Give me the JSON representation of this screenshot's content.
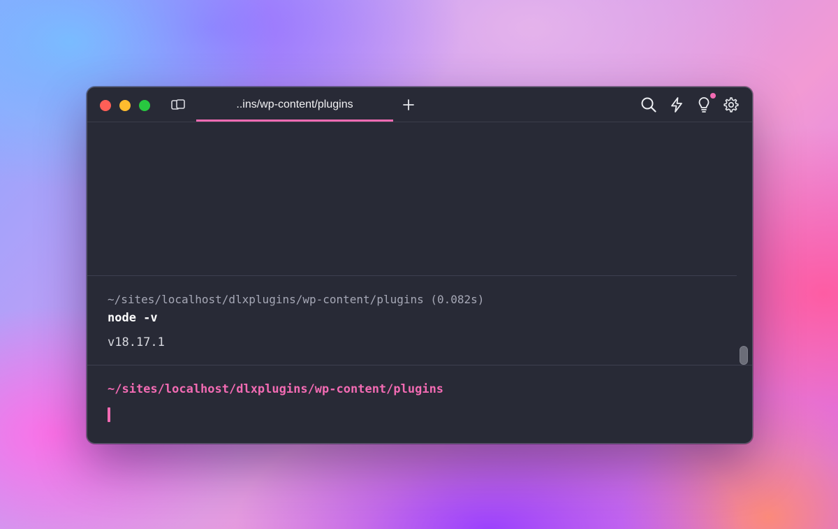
{
  "window": {
    "controls": [
      "close",
      "minimize",
      "maximize"
    ]
  },
  "tabs": [
    {
      "label": "..ins/wp-content/plugins",
      "active": true
    }
  ],
  "toolbar": {
    "icons": [
      "search-icon",
      "lightning-icon",
      "lightbulb-icon",
      "gear-icon"
    ],
    "notification_dot": true
  },
  "terminal": {
    "previous_block": {
      "path": "~/sites/localhost/dlxplugins/wp-content/plugins (0.082s)",
      "command": "node -v",
      "output": "v18.17.1"
    },
    "prompt": {
      "path": "~/sites/localhost/dlxplugins/wp-content/plugins"
    }
  },
  "colors": {
    "accent": "#f26bb3",
    "background": "#282a36",
    "traffic_close": "#ff5f57",
    "traffic_minimize": "#febc2e",
    "traffic_maximize": "#28c840"
  }
}
